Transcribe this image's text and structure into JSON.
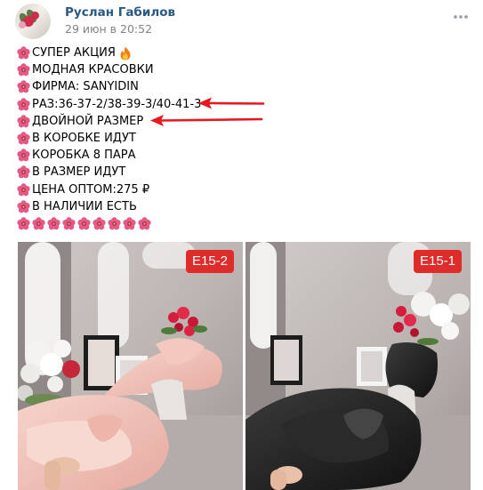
{
  "post": {
    "author": "Руслан Габилов",
    "date": "29 июн в 20:52",
    "lines": [
      "СУПЕР АКЦИЯ",
      "МОДНАЯ КРАСОВКИ",
      "ФИРМА: SANYIDIN",
      "РАЗ:36-37-2/38-39-3/40-41-3",
      "ДВОЙНОЙ РАЗМЕР",
      "В КОРОБКЕ ИДУТ",
      "КОРОБКА 8 ПАРА",
      "В РАЗМЕР ИДУТ",
      "ЦЕНА ОПТОМ:275 ₽",
      "В НАЛИЧИИ ЕСТЬ"
    ],
    "emoji_row_count": 9,
    "photos": [
      {
        "label": "E15-2",
        "slide_color": "pink"
      },
      {
        "label": "E15-1",
        "slide_color": "black"
      }
    ]
  },
  "icons": {
    "line_marker": "hibiscus-icon",
    "title_emoji": "fire-icon",
    "menu": "more-horizontal-icon"
  },
  "colors": {
    "author": "#2a5885",
    "date": "#828282",
    "arrow": "#e8181e",
    "label_bg": "#e02b2b",
    "hibiscus": "#e25a86"
  }
}
